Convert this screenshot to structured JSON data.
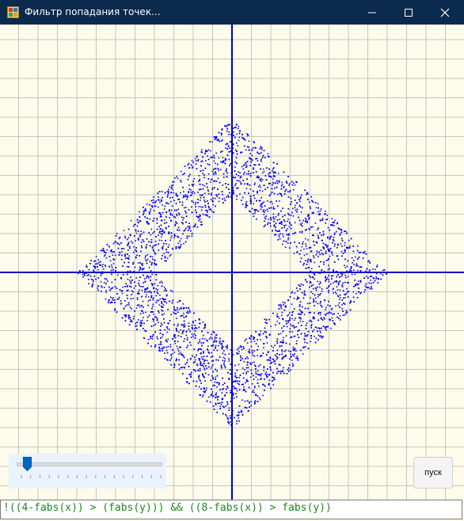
{
  "window": {
    "title": "Фильтр попадания точек...",
    "icons": [
      "app-icon",
      "minimize-icon",
      "maximize-icon",
      "close-icon"
    ]
  },
  "plot": {
    "background": "#fdfbe9",
    "grid_color": "#c4c4c4",
    "axis_color": "#0000cc",
    "point_color": "#0000ff",
    "point_count": 6000,
    "x_range": [
      -10.5,
      10.5
    ],
    "y_range": [
      -10.5,
      10.5
    ],
    "grid_step": 1,
    "region": {
      "outer_radius": 8,
      "inner_radius": 4,
      "shape": "diamond ring"
    }
  },
  "slider": {
    "level": 0.03,
    "tick_count": 16
  },
  "run_button": {
    "label": "пуск"
  },
  "expression": {
    "value": "!((4-fabs(x)) > (fabs(y))) && ((8-fabs(x)) > fabs(y))"
  }
}
